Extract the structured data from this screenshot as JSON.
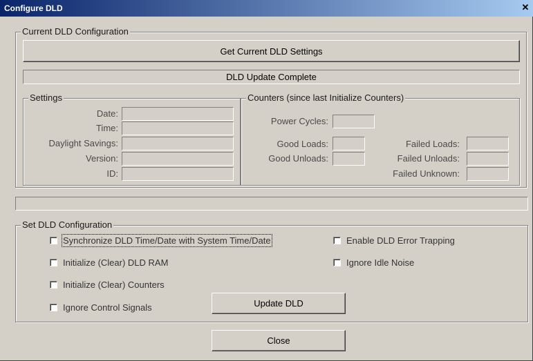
{
  "window": {
    "title": "Configure DLD",
    "close_glyph": "✕"
  },
  "current": {
    "group_label": "Current DLD Configuration",
    "get_button": "Get Current DLD Settings",
    "status": "DLD Update Complete"
  },
  "settings": {
    "group_label": "Settings",
    "fields": [
      {
        "label": "Date:",
        "value": ""
      },
      {
        "label": "Time:",
        "value": ""
      },
      {
        "label": "Daylight Savings:",
        "value": ""
      },
      {
        "label": "Version:",
        "value": ""
      },
      {
        "label": "ID:",
        "value": ""
      }
    ]
  },
  "counters": {
    "group_label": "Counters (since last Initialize Counters)",
    "power_cycles": {
      "label": "Power Cycles:",
      "value": ""
    },
    "good_loads": {
      "label": "Good Loads:",
      "value": ""
    },
    "good_unloads": {
      "label": "Good Unloads:",
      "value": ""
    },
    "failed_loads": {
      "label": "Failed Loads:",
      "value": ""
    },
    "failed_unloads": {
      "label": "Failed Unloads:",
      "value": ""
    },
    "failed_unknown": {
      "label": "Failed Unknown:",
      "value": ""
    }
  },
  "progress": {
    "value": 0
  },
  "set": {
    "group_label": "Set DLD Configuration",
    "options": [
      {
        "label": "Synchronize DLD Time/Date with System Time/Date",
        "checked": false
      },
      {
        "label": "Initialize (Clear) DLD RAM",
        "checked": false
      },
      {
        "label": "Initialize (Clear) Counters",
        "checked": false
      },
      {
        "label": "Ignore Control Signals",
        "checked": false
      },
      {
        "label": "Enable DLD Error Trapping",
        "checked": false
      },
      {
        "label": "Ignore Idle Noise",
        "checked": false
      }
    ],
    "update_button": "Update DLD"
  },
  "close_button": "Close"
}
